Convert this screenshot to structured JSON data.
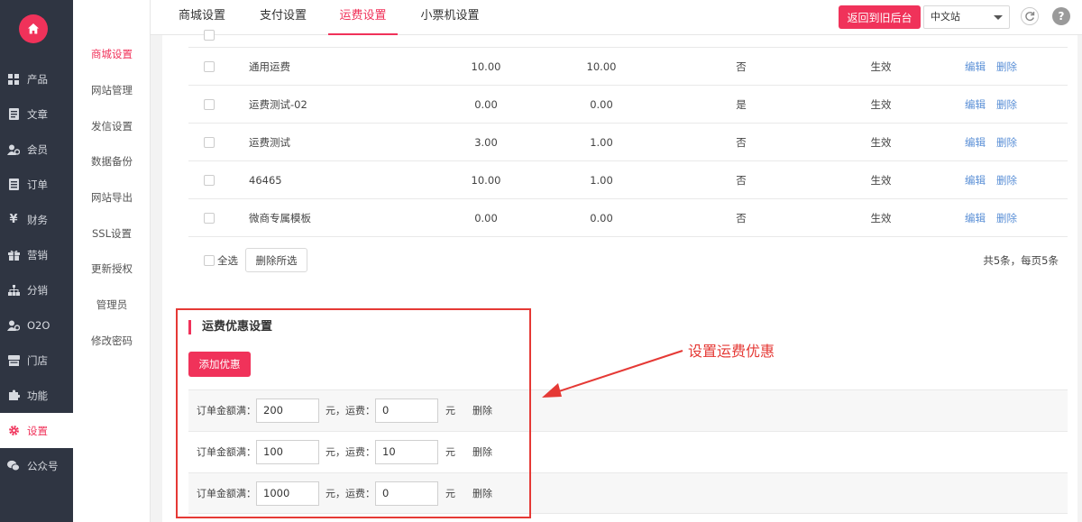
{
  "sidebar": {
    "logo_icon": "home-icon",
    "items": [
      {
        "label": "产品",
        "icon": "grid-icon"
      },
      {
        "label": "文章",
        "icon": "document-icon"
      },
      {
        "label": "会员",
        "icon": "users-icon"
      },
      {
        "label": "订单",
        "icon": "order-icon"
      },
      {
        "label": "财务",
        "icon": "yen-icon"
      },
      {
        "label": "营销",
        "icon": "gift-icon"
      },
      {
        "label": "分销",
        "icon": "sitemap-icon"
      },
      {
        "label": "O2O",
        "icon": "o2o-icon"
      },
      {
        "label": "门店",
        "icon": "store-icon"
      },
      {
        "label": "功能",
        "icon": "puzzle-icon"
      },
      {
        "label": "设置",
        "icon": "gear-icon",
        "active": true
      },
      {
        "label": "公众号",
        "icon": "wechat-icon"
      }
    ]
  },
  "submenu": {
    "items": [
      {
        "label": "商城设置",
        "active": true
      },
      {
        "label": "网站管理"
      },
      {
        "label": "发信设置"
      },
      {
        "label": "数据备份"
      },
      {
        "label": "网站导出"
      },
      {
        "label": "SSL设置"
      },
      {
        "label": "更新授权"
      },
      {
        "label": "管理员"
      },
      {
        "label": "修改密码"
      }
    ]
  },
  "topbar": {
    "tabs": [
      {
        "label": "商城设置"
      },
      {
        "label": "支付设置"
      },
      {
        "label": "运费设置",
        "active": true
      },
      {
        "label": "小票机设置"
      }
    ],
    "back_button": "返回到旧后台",
    "site_select": "中文站",
    "refresh_icon": "refresh-icon",
    "help_icon": "help-icon"
  },
  "table": {
    "rows": [
      {
        "name": "通用运费",
        "v1": "10.00",
        "v2": "10.00",
        "flag": "否",
        "status": "生效"
      },
      {
        "name": "运费测试-02",
        "v1": "0.00",
        "v2": "0.00",
        "flag": "是",
        "status": "生效"
      },
      {
        "name": "运费测试",
        "v1": "3.00",
        "v2": "1.00",
        "flag": "否",
        "status": "生效"
      },
      {
        "name": "46465",
        "v1": "10.00",
        "v2": "1.00",
        "flag": "否",
        "status": "生效"
      },
      {
        "name": "微商专属模板",
        "v1": "0.00",
        "v2": "0.00",
        "flag": "否",
        "status": "生效"
      }
    ],
    "edit_label": "编辑",
    "delete_label": "删除",
    "select_all": "全选",
    "delete_selected": "删除所选",
    "pagination": "共5条，每页5条"
  },
  "discount": {
    "title": "运费优惠设置",
    "add_button": "添加优惠",
    "amount_label": "订单金额满：",
    "fee_label": "元，运费：",
    "unit": "元",
    "delete_label": "删除",
    "rows": [
      {
        "amount": "200",
        "fee": "0"
      },
      {
        "amount": "100",
        "fee": "10"
      },
      {
        "amount": "1000",
        "fee": "0"
      }
    ]
  },
  "annotation": {
    "text": "设置运费优惠",
    "color": "#e53935"
  },
  "colors": {
    "accent": "#f0325a",
    "sidebar_bg": "#2f3542",
    "link": "#5a8fd6"
  }
}
